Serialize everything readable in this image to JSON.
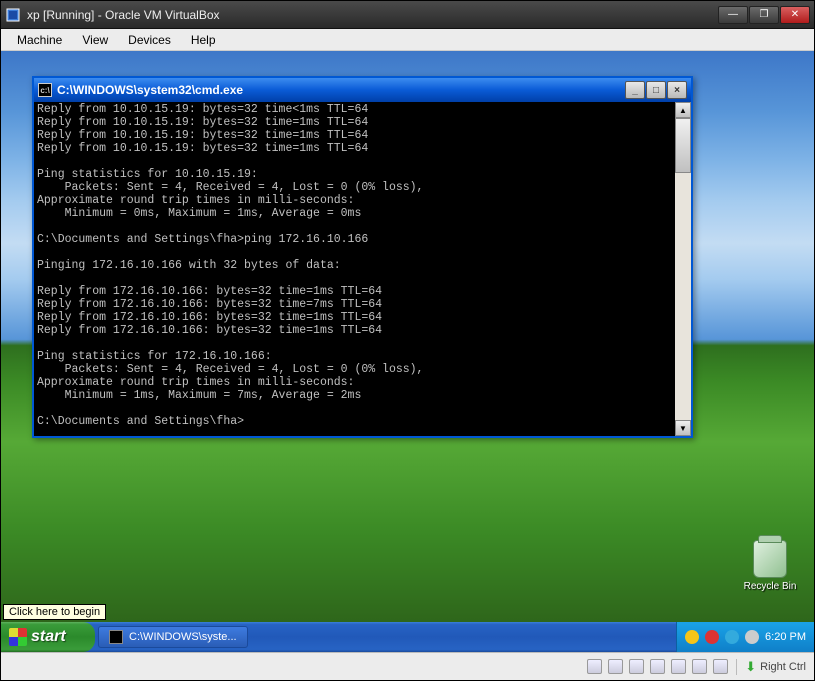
{
  "vbox": {
    "title": "xp [Running] - Oracle VM VirtualBox",
    "menu": {
      "machine": "Machine",
      "view": "View",
      "devices": "Devices",
      "help": "Help"
    },
    "status": {
      "hostkey": "Right Ctrl"
    }
  },
  "xp": {
    "start_label": "start",
    "start_tooltip": "Click here to begin",
    "taskbar_item": "C:\\WINDOWS\\syste...",
    "recycle_bin": "Recycle Bin",
    "clock": "6:20 PM"
  },
  "cmd": {
    "title": "C:\\WINDOWS\\system32\\cmd.exe",
    "lines": [
      "Reply from 10.10.15.19: bytes=32 time<1ms TTL=64",
      "Reply from 10.10.15.19: bytes=32 time=1ms TTL=64",
      "Reply from 10.10.15.19: bytes=32 time=1ms TTL=64",
      "Reply from 10.10.15.19: bytes=32 time=1ms TTL=64",
      "",
      "Ping statistics for 10.10.15.19:",
      "    Packets: Sent = 4, Received = 4, Lost = 0 (0% loss),",
      "Approximate round trip times in milli-seconds:",
      "    Minimum = 0ms, Maximum = 1ms, Average = 0ms",
      "",
      "C:\\Documents and Settings\\fha>ping 172.16.10.166",
      "",
      "Pinging 172.16.10.166 with 32 bytes of data:",
      "",
      "Reply from 172.16.10.166: bytes=32 time=1ms TTL=64",
      "Reply from 172.16.10.166: bytes=32 time=7ms TTL=64",
      "Reply from 172.16.10.166: bytes=32 time=1ms TTL=64",
      "Reply from 172.16.10.166: bytes=32 time=1ms TTL=64",
      "",
      "Ping statistics for 172.16.10.166:",
      "    Packets: Sent = 4, Received = 4, Lost = 0 (0% loss),",
      "Approximate round trip times in milli-seconds:",
      "    Minimum = 1ms, Maximum = 7ms, Average = 2ms",
      "",
      "C:\\Documents and Settings\\fha>"
    ]
  }
}
